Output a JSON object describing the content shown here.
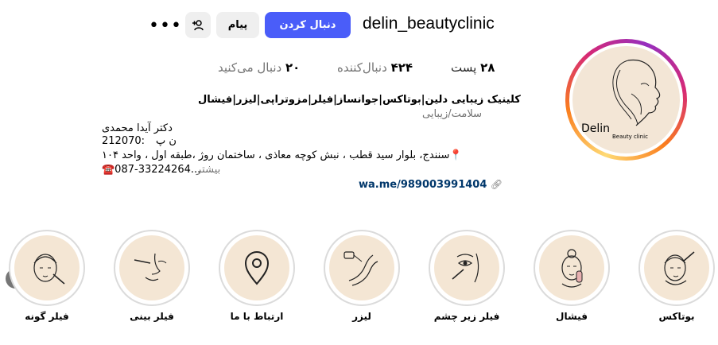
{
  "profile": {
    "username": "delin_beautyclinic",
    "logo_text": "Delin",
    "logo_subtext": "Beauty clinic"
  },
  "actions": {
    "follow_label": "دنبال کردن",
    "message_label": "پیام",
    "more_glyph": "•••"
  },
  "stats": {
    "posts_value": "۲۸",
    "posts_label": "پست",
    "followers_value": "۴۲۴",
    "followers_label": "دنبال‌کننده",
    "following_value": "۲۰",
    "following_label": "دنبال می‌کنید"
  },
  "bio": {
    "title": "کلینیک زیبایی دلین|بوتاکس|جوانساز|فیلر|مزوتراپی|لیزر|فیشال",
    "category": "سلامت/زیبایی",
    "name_line": "دکتر آیدا محمدی",
    "np_line": "ن پ",
    "code_line": "212070:",
    "address_line": "📍سنندج، بلوار سید قطب ، نبش کوچه معاذی ، ساختمان روژ ،طبقه اول ، واحد ۱۰۴",
    "phone_line": "☎️087-33224264...",
    "more_label": "بیشتر",
    "link": "wa.me/989003991404"
  },
  "highlights": [
    {
      "label": "بوتاکس",
      "icon": "botox-face-icon"
    },
    {
      "label": "فیشال",
      "icon": "facial-face-icon"
    },
    {
      "label": "فیلر زیر چشم",
      "icon": "under-eye-filler-icon"
    },
    {
      "label": "لیزر",
      "icon": "laser-legs-icon"
    },
    {
      "label": "ارتباط با ما",
      "icon": "location-pin-icon"
    },
    {
      "label": "فیلر بینی",
      "icon": "nose-filler-icon"
    },
    {
      "label": "فیلر گونه",
      "icon": "cheek-filler-icon"
    }
  ]
}
